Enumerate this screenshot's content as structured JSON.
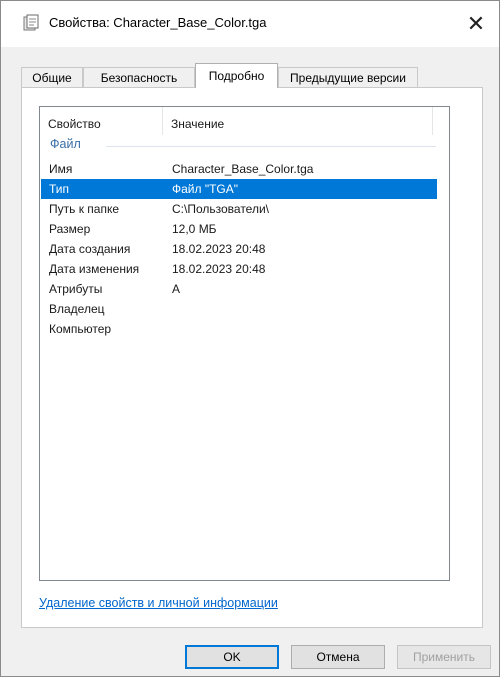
{
  "window": {
    "title": "Свойства: Character_Base_Color.tga",
    "title_icon": "file-properties-icon",
    "close_glyph": "✕"
  },
  "tabs": [
    {
      "label": "Общие",
      "active": false
    },
    {
      "label": "Безопасность",
      "active": false
    },
    {
      "label": "Подробно",
      "active": true
    },
    {
      "label": "Предыдущие версии",
      "active": false
    }
  ],
  "details": {
    "columns": {
      "property": "Свойство",
      "value": "Значение"
    },
    "group": "Файл",
    "rows": [
      {
        "property": "Имя",
        "value": "Character_Base_Color.tga",
        "selected": false
      },
      {
        "property": "Тип",
        "value": "Файл \"TGA\"",
        "selected": true
      },
      {
        "property": "Путь к папке",
        "value": "C:\\Пользователи\\",
        "selected": false
      },
      {
        "property": "Размер",
        "value": "12,0 МБ",
        "selected": false
      },
      {
        "property": "Дата создания",
        "value": "18.02.2023 20:48",
        "selected": false
      },
      {
        "property": "Дата изменения",
        "value": "18.02.2023 20:48",
        "selected": false
      },
      {
        "property": "Атрибуты",
        "value": "A",
        "selected": false
      },
      {
        "property": "Владелец",
        "value": "",
        "selected": false
      },
      {
        "property": "Компьютер",
        "value": "",
        "selected": false
      }
    ]
  },
  "remove_link": "Удаление свойств и личной информации",
  "buttons": {
    "ok": "OK",
    "cancel": "Отмена",
    "apply": "Применить"
  },
  "colors": {
    "selection": "#0078d7",
    "group": "#3a6ea5",
    "link": "#0066cc"
  }
}
